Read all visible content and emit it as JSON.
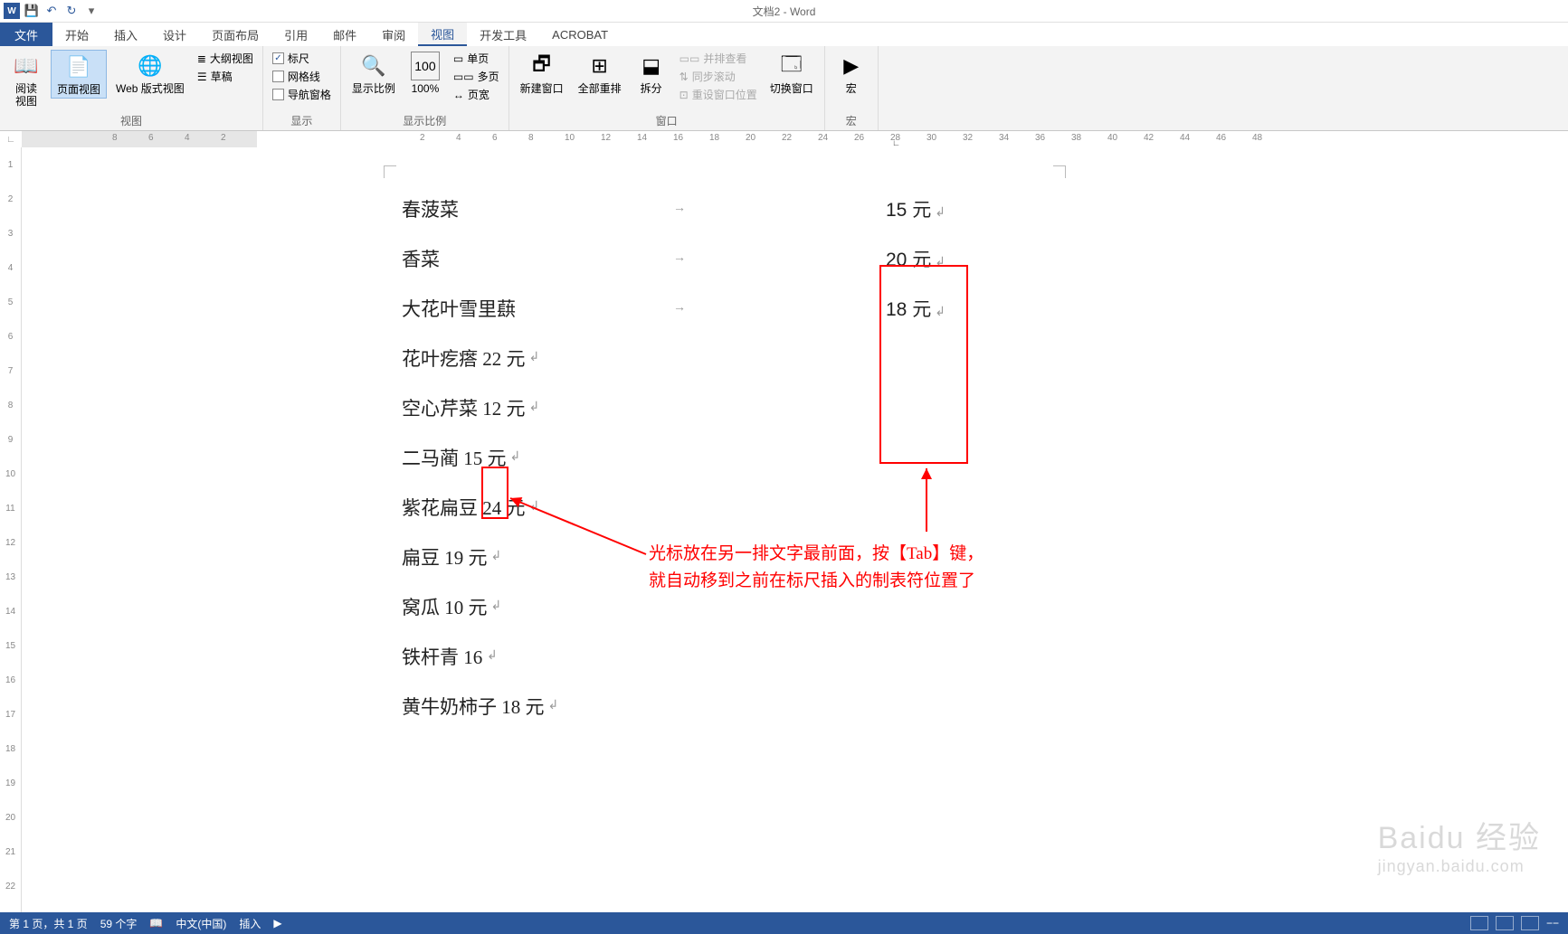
{
  "title": "文档2 - Word",
  "qat": {
    "save": "💾",
    "undo": "↶",
    "redo": "↻"
  },
  "tabs": {
    "file": "文件",
    "home": "开始",
    "insert": "插入",
    "design": "设计",
    "layout": "页面布局",
    "references": "引用",
    "mailings": "邮件",
    "review": "审阅",
    "view": "视图",
    "dev": "开发工具",
    "acrobat": "ACROBAT"
  },
  "ribbon": {
    "views": {
      "read": "阅读\n视图",
      "page": "页面视图",
      "web": "Web 版式视图",
      "outline": "大纲视图",
      "draft": "草稿",
      "group": "视图"
    },
    "show": {
      "ruler": "标尺",
      "gridlines": "网格线",
      "navpane": "导航窗格",
      "group": "显示"
    },
    "zoom": {
      "zoom": "显示比例",
      "hundred": "100%",
      "onepage": "单页",
      "multipage": "多页",
      "pagewidth": "页宽",
      "group": "显示比例"
    },
    "window": {
      "newwin": "新建窗口",
      "arrange": "全部重排",
      "split": "拆分",
      "sidebyside": "并排查看",
      "syncscroll": "同步滚动",
      "resetpos": "重设窗口位置",
      "switchwin": "切换窗口",
      "group": "窗口"
    },
    "macros": {
      "macros": "宏",
      "group": "宏"
    }
  },
  "doc": {
    "rows_tabbed": [
      {
        "name": "春菠菜",
        "price": "15 元"
      },
      {
        "name": "香菜",
        "price": "20 元"
      },
      {
        "name": "大花叶雪里蕻",
        "price": "18 元"
      }
    ],
    "rows_inline": [
      {
        "text": "花叶疙瘩 22 元"
      },
      {
        "text": "空心芹菜 12 元"
      },
      {
        "text": "二马蔺 15 元"
      },
      {
        "text": "紫花扁豆 24 元"
      },
      {
        "text": "扁豆 19 元"
      },
      {
        "text": "窝瓜 10 元"
      },
      {
        "text": "铁杆青 16"
      },
      {
        "text": "黄牛奶柿子 18 元"
      }
    ]
  },
  "annotation": {
    "line1": "光标放在另一排文字最前面，按【Tab】键，",
    "line2": "就自动移到之前在标尺插入的制表符位置了"
  },
  "status": {
    "page": "第 1 页，共 1 页",
    "words": "59 个字",
    "lang": "中文(中国)",
    "mode": "插入"
  },
  "watermark": {
    "main": "Baidu 经验",
    "sub": "jingyan.baidu.com"
  }
}
